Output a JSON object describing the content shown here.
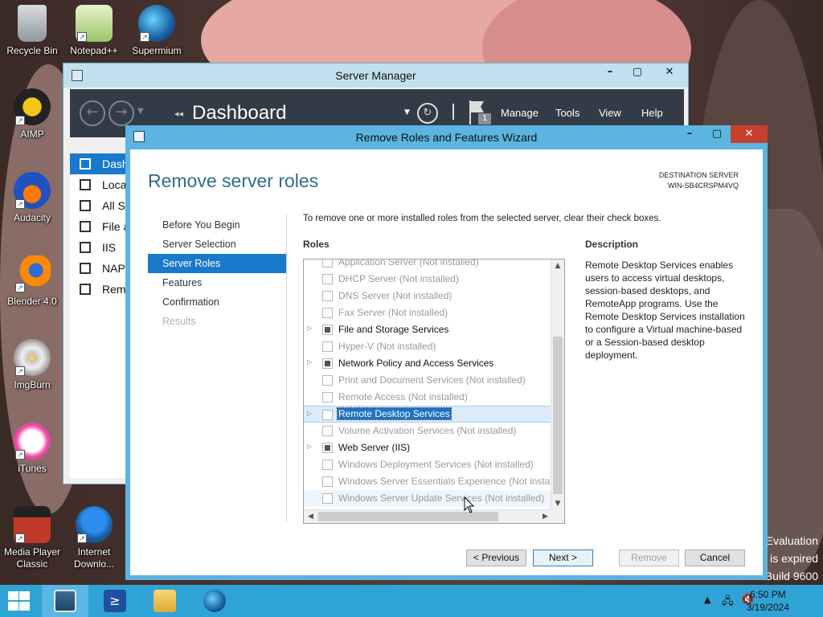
{
  "desktop": {
    "icons": [
      {
        "label": "Recycle Bin"
      },
      {
        "label": "Notepad++"
      },
      {
        "label": "Supermium"
      },
      {
        "label": "AIMP"
      },
      {
        "label": "Audacity"
      },
      {
        "label": "Blender 4.0"
      },
      {
        "label": "ImgBurn"
      },
      {
        "label": "iTunes"
      },
      {
        "label": "Media Player Classic"
      },
      {
        "label": "Internet Downlo..."
      }
    ],
    "watermark": {
      "line1": "Evaluation",
      "line2": "is expired",
      "line3": "Build 9600"
    }
  },
  "server_manager": {
    "title": "Server Manager",
    "breadcrumb_arrows": "◂◂",
    "page_title": "Dashboard",
    "flag_count": "1",
    "menu": [
      "Manage",
      "Tools",
      "View",
      "Help"
    ],
    "nav_items": [
      "Dashboard",
      "Local Server",
      "All Servers",
      "File and Storage Services",
      "IIS",
      "NAP",
      "Remote Desktop Services"
    ]
  },
  "wizard": {
    "title": "Remove Roles and Features Wizard",
    "heading": "Remove server roles",
    "destination_label": "DESTINATION SERVER",
    "destination_server": "WIN-SB4CRSPM4VQ",
    "steps": [
      {
        "label": "Before You Begin",
        "state": "normal"
      },
      {
        "label": "Server Selection",
        "state": "normal"
      },
      {
        "label": "Server Roles",
        "state": "selected"
      },
      {
        "label": "Features",
        "state": "normal"
      },
      {
        "label": "Confirmation",
        "state": "normal"
      },
      {
        "label": "Results",
        "state": "disabled"
      }
    ],
    "instruction": "To remove one or more installed roles from the selected server, clear their check boxes.",
    "roles_header": "Roles",
    "roles": [
      {
        "label": "Application Server (Not installed)",
        "checked": false,
        "expandable": false,
        "installed": false
      },
      {
        "label": "DHCP Server (Not installed)",
        "checked": false,
        "expandable": false,
        "installed": false
      },
      {
        "label": "DNS Server (Not installed)",
        "checked": false,
        "expandable": false,
        "installed": false
      },
      {
        "label": "Fax Server (Not installed)",
        "checked": false,
        "expandable": false,
        "installed": false
      },
      {
        "label": "File and Storage Services",
        "checked": true,
        "expandable": true,
        "installed": true
      },
      {
        "label": "Hyper-V (Not installed)",
        "checked": false,
        "expandable": false,
        "installed": false
      },
      {
        "label": "Network Policy and Access Services",
        "checked": true,
        "expandable": true,
        "installed": true
      },
      {
        "label": "Print and Document Services (Not installed)",
        "checked": false,
        "expandable": false,
        "installed": false
      },
      {
        "label": "Remote Access (Not installed)",
        "checked": false,
        "expandable": false,
        "installed": false
      },
      {
        "label": "Remote Desktop Services",
        "checked": false,
        "expandable": true,
        "installed": true,
        "selected": true
      },
      {
        "label": "Volume Activation Services (Not installed)",
        "checked": false,
        "expandable": false,
        "installed": false
      },
      {
        "label": "Web Server (IIS)",
        "checked": true,
        "expandable": true,
        "installed": true
      },
      {
        "label": "Windows Deployment Services (Not installed)",
        "checked": false,
        "expandable": false,
        "installed": false
      },
      {
        "label": "Windows Server Essentials Experience (Not installed)",
        "checked": false,
        "expandable": false,
        "installed": false
      },
      {
        "label": "Windows Server Update Services (Not installed)",
        "checked": false,
        "expandable": false,
        "installed": false,
        "hover": true
      }
    ],
    "description_header": "Description",
    "description": "Remote Desktop Services enables users to access virtual desktops, session-based desktops, and RemoteApp programs. Use the Remote Desktop Services installation to configure a Virtual machine-based or a Session-based desktop deployment.",
    "buttons": {
      "previous": "< Previous",
      "next": "Next >",
      "remove": "Remove",
      "cancel": "Cancel"
    }
  },
  "taskbar": {
    "time": "6:50 PM",
    "date": "3/19/2024"
  }
}
